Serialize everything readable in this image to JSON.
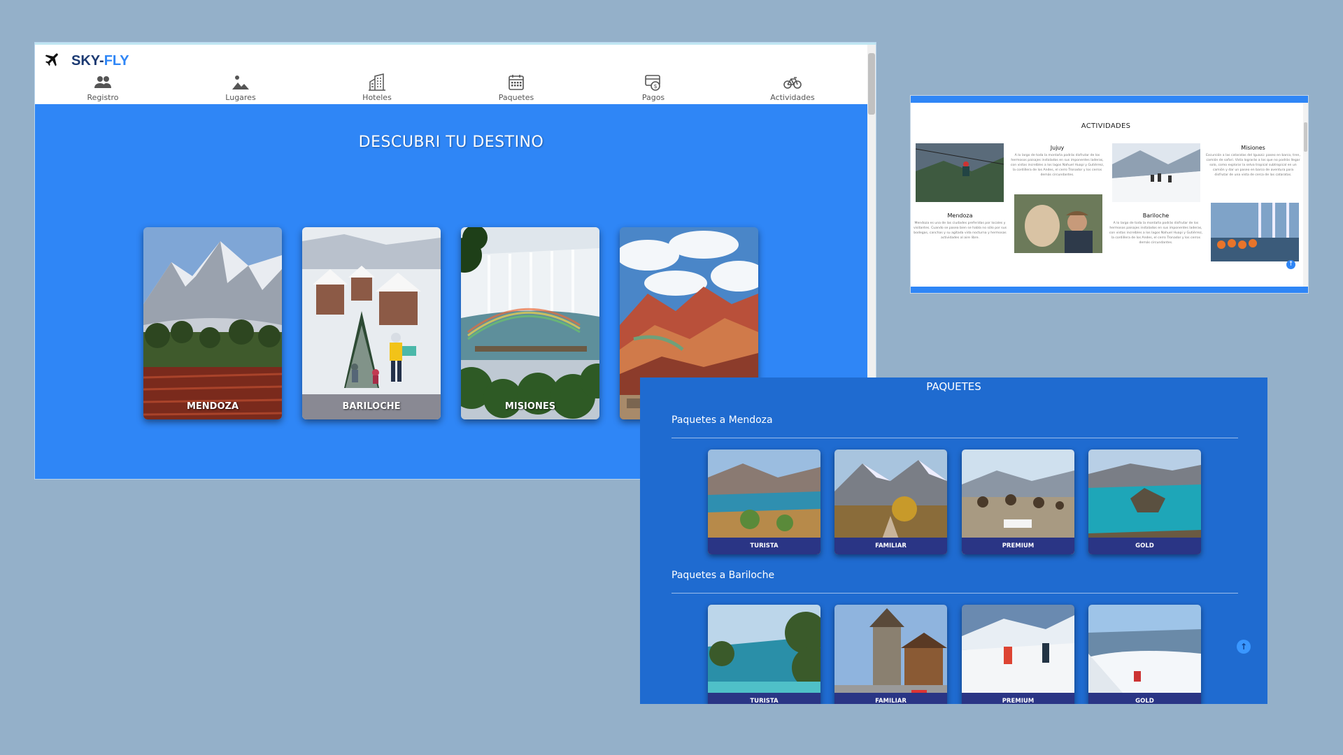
{
  "brand": {
    "name_main": "SKY-",
    "name_accent": "FLY"
  },
  "nav": [
    {
      "label": "Registro",
      "icon": "users-icon"
    },
    {
      "label": "Lugares",
      "icon": "landscape-icon"
    },
    {
      "label": "Hoteles",
      "icon": "building-icon"
    },
    {
      "label": "Paquetes",
      "icon": "calendar-icon"
    },
    {
      "label": "Pagos",
      "icon": "payment-icon"
    },
    {
      "label": "Actividades",
      "icon": "bicycle-icon"
    }
  ],
  "hero": {
    "title": "DESCUBRI TU DESTINO",
    "destinations": [
      {
        "label": "MENDOZA"
      },
      {
        "label": "BARILOCHE"
      },
      {
        "label": "MISIONES"
      },
      {
        "label": ""
      }
    ]
  },
  "activities": {
    "title": "ACTIVIDADES",
    "items": [
      {
        "name": "Jujuy",
        "text": "A lo largo de toda la montaña podrás disfrutar de los hermosos paisajes instalados en sus imponentes laderas, con vistas increíbles a los lagos Nahuel Huapi y Gutiérrez, la cordillera de los Andes, el cerro Tronador y los cerros demás circundantes."
      },
      {
        "name": "Misiones",
        "text": "Excursión a las cataratas del Iguazú: paseo en barco, tren, camión de safari. Vista lograrás a los que no podrás llegar solo, como explorar la selva tropical subtropical en un camión y dar un paseo en barco de aventura para disfrutar de una vista de cerca de las cataratas."
      },
      {
        "name": "Mendoza",
        "text": "Mendoza es una de las ciudades preferidas por locales y visitantes. Cuando se pasea bien se habla no sólo por sus bodegas, canchas y su agitada vida nocturna y hermosas actividades al aire libre."
      },
      {
        "name": "Bariloche",
        "text": "A lo largo de toda la montaña podrás disfrutar de los hermosos paisajes instalados en sus imponentes laderas, con vistas increíbles a los lagos Nahuel Huapi y Gutiérrez, la cordillera de los Andes, el cerro Tronador y los cerros demás circundantes."
      }
    ]
  },
  "paquetes": {
    "title": "PAQUETES",
    "sections": [
      {
        "title": "Paquetes a Mendoza",
        "cards": [
          "TURISTA",
          "FAMILIAR",
          "PREMIUM",
          "GOLD"
        ]
      },
      {
        "title": "Paquetes a Bariloche",
        "cards": [
          "TURISTA",
          "FAMILIAR",
          "PREMIUM",
          "GOLD"
        ]
      }
    ]
  },
  "colors": {
    "accent": "#2f86f6",
    "paquetes_bg": "#1f6bd0",
    "brand_dark": "#1c3a72",
    "page_bg": "#94b0c9"
  }
}
